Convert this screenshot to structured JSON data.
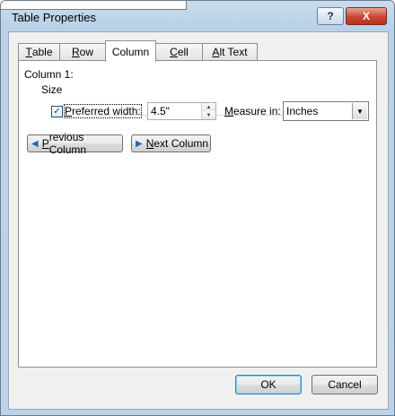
{
  "window": {
    "title": "Table Properties",
    "help_glyph": "?",
    "close_glyph": "X"
  },
  "tabs": [
    {
      "label": "Table",
      "u": "T",
      "rest": "able"
    },
    {
      "label": "Row",
      "u": "R",
      "rest": "ow"
    },
    {
      "label": "Column",
      "u": "",
      "rest": "Column"
    },
    {
      "label": "Cell",
      "u": "C",
      "rest": "ell"
    },
    {
      "label": "Alt Text",
      "u": "A",
      "rest": "lt Text"
    }
  ],
  "active_tab": "Column",
  "column": {
    "heading": "Column 1:",
    "size_label": "Size",
    "preferred_width": {
      "checked": true,
      "check_glyph": "✓",
      "u": "P",
      "rest": "referred width:",
      "value": "4.5\""
    },
    "measure_in": {
      "u": "M",
      "rest": "easure in:",
      "value": "Inches"
    }
  },
  "nav": {
    "previous": {
      "icon": "◀",
      "u": "P",
      "rest": "revious Column"
    },
    "next": {
      "icon": "▶",
      "u": "N",
      "rest": "ext Column"
    }
  },
  "footer": {
    "ok": "OK",
    "cancel": "Cancel"
  }
}
